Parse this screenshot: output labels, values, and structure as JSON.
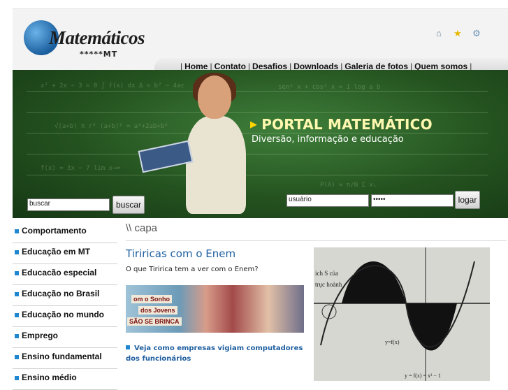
{
  "header": {
    "logo_title": "Matemáticos",
    "logo_sub": "*****MT",
    "icons": [
      "home-icon",
      "favorite-star-icon",
      "settings-icon"
    ]
  },
  "nav": {
    "items": [
      "Home",
      "Contato",
      "Desafios",
      "Downloads",
      "Galeria de fotos",
      "Quem somos"
    ]
  },
  "banner": {
    "title": "PORTAL MATEMÁTICO",
    "subtitle": "Diversão, informação e educação"
  },
  "search": {
    "value": "buscar",
    "button": "buscar"
  },
  "login": {
    "user_value": "usuário",
    "pass_value": "•••••",
    "button": "logar"
  },
  "sidebar": {
    "items": [
      "Comportamento",
      "Educação em MT",
      "Educacão especial",
      "Educação no Brasil",
      "Educação no mundo",
      "Emprego",
      "Ensino fundamental",
      "Ensino médio"
    ]
  },
  "main": {
    "breadcrumb": "\\\\ capa",
    "headline": "Tiriricas com o Enem",
    "teaser": "O que Tiririca tem a ver com o Enem?",
    "photo_signs": [
      "om o Sonho",
      "dos Jovens",
      "SÃO SE BRINCA"
    ],
    "link": "Veja como empresas vigiam computadores dos funcionários",
    "graph_labels": [
      "ich S của",
      "trục hoành",
      "y=f(x)",
      "y = f(x) = x³ − 1"
    ]
  },
  "colors": {
    "accent": "#1f86d0",
    "link": "#1f5fa0",
    "banner": "#24521f"
  }
}
